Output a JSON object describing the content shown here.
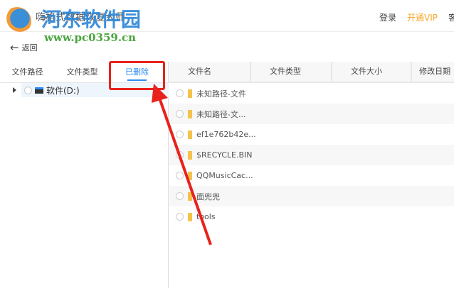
{
  "header": {
    "title": "嗨格式数据恢复大师",
    "login": "登录",
    "vip": "开通VIP",
    "more": "客"
  },
  "watermark": {
    "name": "河东软件园",
    "url": "www.pc0359.cn"
  },
  "back_label": "返回",
  "left_tabs": [
    "文件路径",
    "文件类型",
    "已删除"
  ],
  "tree": {
    "drive": "软件(D:)"
  },
  "columns": [
    "文件名",
    "文件类型",
    "文件大小",
    "修改日期"
  ],
  "files": [
    "未知路径-文件",
    "未知路径-文...",
    "ef1e762b42e...",
    "$RECYCLE.BIN",
    "QQMusicCac...",
    "面兜兜",
    "tools"
  ],
  "colors": {
    "accent": "#2d8cf0",
    "vip": "#f6a623",
    "annotation": "#e8221c"
  }
}
